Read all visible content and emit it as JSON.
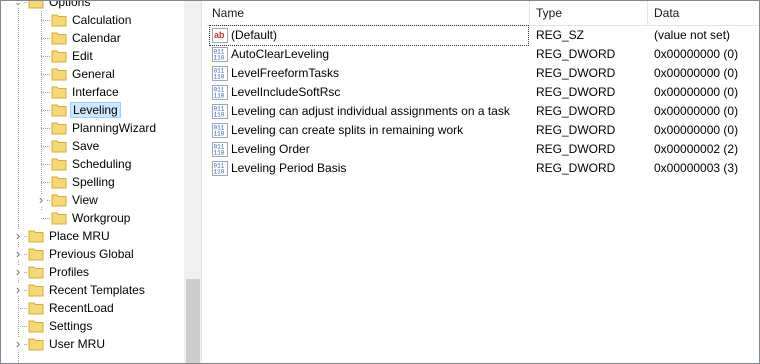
{
  "tree": {
    "items": [
      {
        "label": "Options",
        "expanded": true,
        "has_children": true
      },
      {
        "label": "Calculation"
      },
      {
        "label": "Calendar"
      },
      {
        "label": "Edit"
      },
      {
        "label": "General"
      },
      {
        "label": "Interface"
      },
      {
        "label": "Leveling",
        "selected": true
      },
      {
        "label": "PlanningWizard"
      },
      {
        "label": "Save"
      },
      {
        "label": "Scheduling"
      },
      {
        "label": "Spelling"
      },
      {
        "label": "View",
        "has_children": true
      },
      {
        "label": "Workgroup"
      },
      {
        "label": "Place MRU",
        "has_children": true
      },
      {
        "label": "Previous Global",
        "has_children": true
      },
      {
        "label": "Profiles",
        "has_children": true
      },
      {
        "label": "Recent Templates",
        "has_children": true
      },
      {
        "label": "RecentLoad"
      },
      {
        "label": "Settings"
      },
      {
        "label": "User MRU",
        "has_children": true
      }
    ]
  },
  "list": {
    "columns": {
      "name": "Name",
      "type": "Type",
      "data": "Data"
    },
    "rows": [
      {
        "icon": "string-value-icon",
        "name": "(Default)",
        "type": "REG_SZ",
        "data": "(value not set)"
      },
      {
        "icon": "dword-value-icon",
        "name": "AutoClearLeveling",
        "type": "REG_DWORD",
        "data": "0x00000000 (0)"
      },
      {
        "icon": "dword-value-icon",
        "name": "LevelFreeformTasks",
        "type": "REG_DWORD",
        "data": "0x00000000 (0)"
      },
      {
        "icon": "dword-value-icon",
        "name": "LevelIncludeSoftRsc",
        "type": "REG_DWORD",
        "data": "0x00000000 (0)"
      },
      {
        "icon": "dword-value-icon",
        "name": "Leveling can adjust individual assignments on a task",
        "type": "REG_DWORD",
        "data": "0x00000000 (0)"
      },
      {
        "icon": "dword-value-icon",
        "name": "Leveling can create splits in remaining work",
        "type": "REG_DWORD",
        "data": "0x00000000 (0)"
      },
      {
        "icon": "dword-value-icon",
        "name": "Leveling Order",
        "type": "REG_DWORD",
        "data": "0x00000002 (2)"
      },
      {
        "icon": "dword-value-icon",
        "name": "Leveling Period Basis",
        "type": "REG_DWORD",
        "data": "0x00000003 (3)"
      }
    ]
  },
  "colors": {
    "selection": "#cce8ff",
    "folder": "#f8d775",
    "string_icon": "#c0392b",
    "dword_icon": "#2b5fb0"
  }
}
